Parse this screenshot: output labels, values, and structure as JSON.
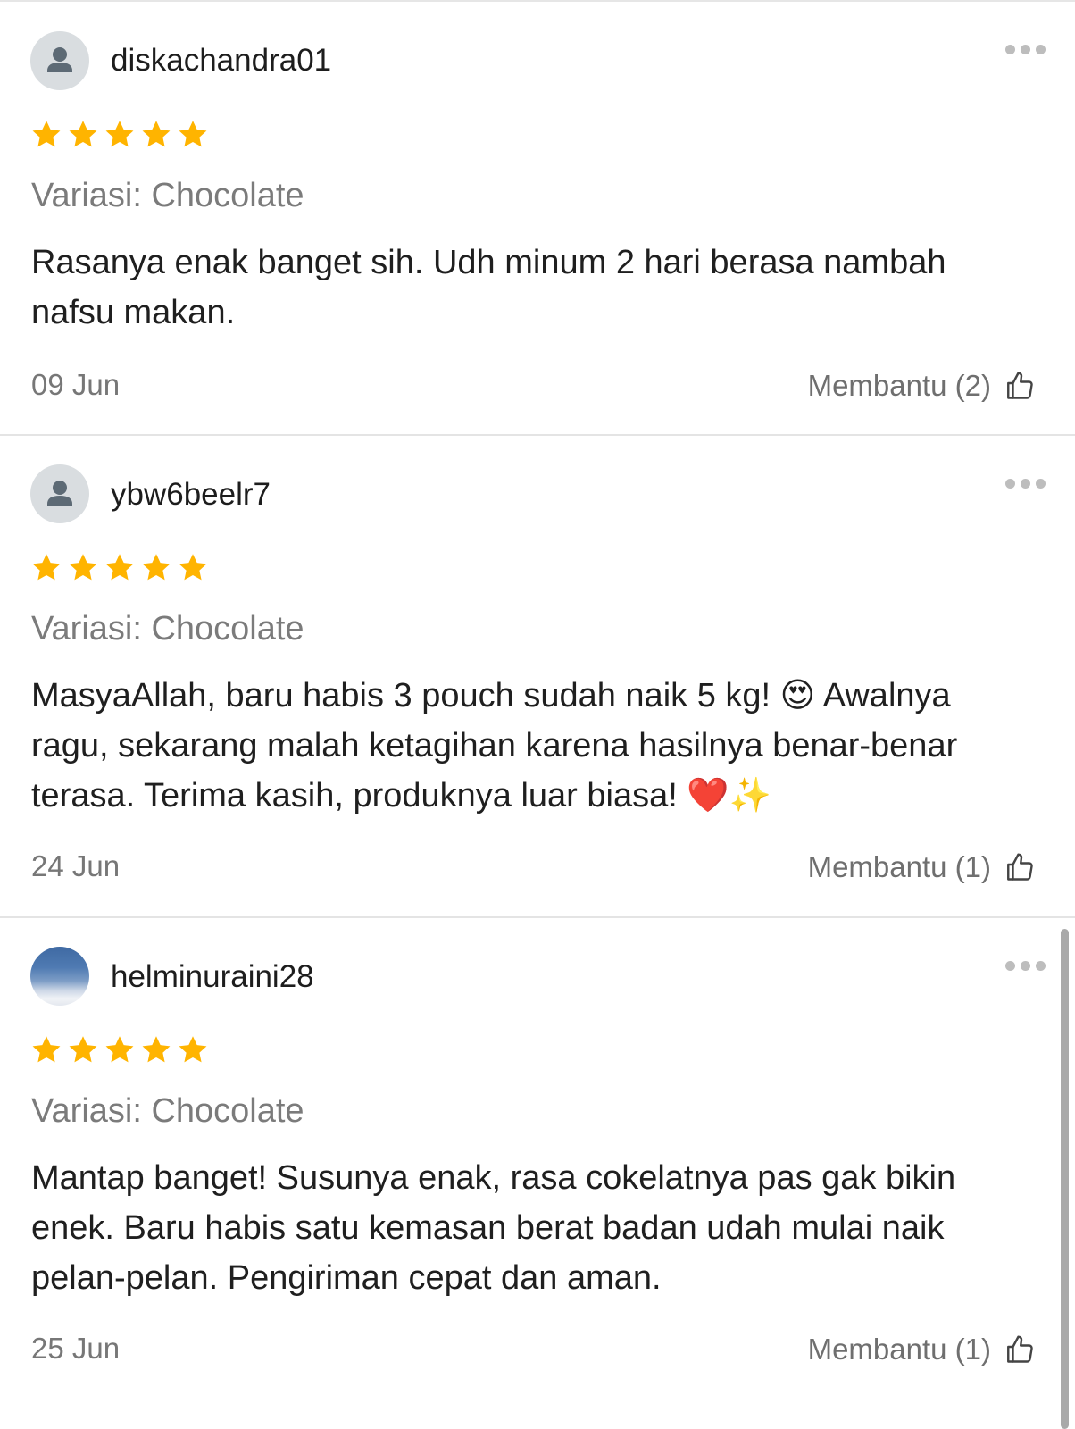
{
  "reviews": [
    {
      "username": "diskachandra01",
      "avatar": "default-user-icon",
      "rating": 5,
      "variant": "Variasi: Chocolate",
      "comment": "Rasanya enak banget sih. Udh minum 2 hari berasa nambah nafsu makan.",
      "date": "09 Jun",
      "helpful": "Membantu (2)"
    },
    {
      "username": "ybw6beelr7",
      "avatar": "default-user-icon",
      "rating": 5,
      "variant": "Variasi: Chocolate",
      "comment": "MasyaAllah, baru habis 3 pouch sudah naik 5 kg! 😍 Awalnya ragu, sekarang malah ketagihan karena hasilnya benar-benar terasa. Terima kasih, produknya luar biasa! ❤️✨",
      "date": "24 Jun",
      "helpful": "Membantu (1)"
    },
    {
      "username": "helminuraini28",
      "avatar": "sky-photo",
      "rating": 5,
      "variant": "Variasi: Chocolate",
      "comment": "Mantap banget! Susunya enak, rasa cokelatnya pas gak bikin enek. Baru habis satu kemasan berat badan udah mulai naik pelan-pelan. Pengiriman cepat dan aman.",
      "date": "25 Jun",
      "helpful": "Membantu (1)"
    }
  ],
  "colors": {
    "star": "#FFB400",
    "muted_text": "#7B7B7B",
    "divider": "#E4E4E4"
  },
  "icons": {
    "more": "more-dots-icon",
    "helpful": "thumbs-up-icon",
    "star": "star-icon"
  }
}
